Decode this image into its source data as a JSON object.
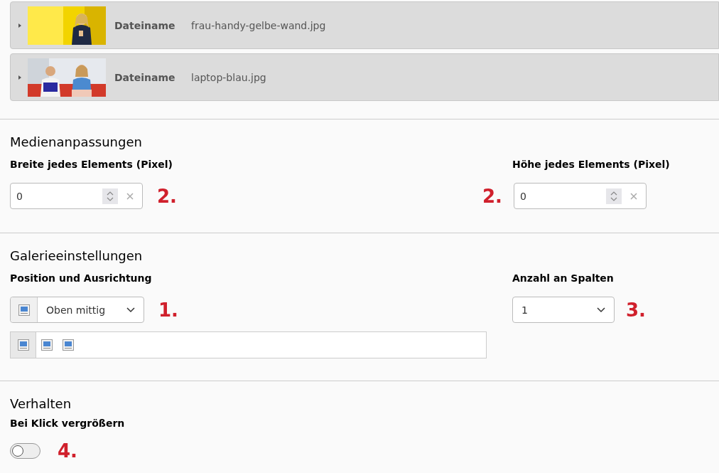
{
  "files": [
    {
      "label": "Dateiname",
      "filename": "frau-handy-gelbe-wand.jpg",
      "expanded": false
    },
    {
      "label": "Dateiname",
      "filename": "laptop-blau.jpg",
      "expanded": false
    }
  ],
  "media": {
    "title": "Medienanpassungen",
    "width": {
      "label": "Breite jedes Elements (Pixel)",
      "value": "0",
      "note": "2."
    },
    "height": {
      "label": "Höhe jedes Elements (Pixel)",
      "value": "0",
      "note": "2."
    }
  },
  "gallery": {
    "title": "Galerieeinstellungen",
    "position": {
      "label": "Position und Ausrichtung",
      "value": "Oben mittig",
      "note": "1.",
      "options": [
        {
          "selected": true
        },
        {
          "selected": false
        },
        {
          "selected": false
        }
      ]
    },
    "columns": {
      "label": "Anzahl an Spalten",
      "value": "1",
      "note": "3."
    }
  },
  "behavior": {
    "title": "Verhalten",
    "zoom": {
      "label": "Bei Klick vergrößern",
      "on": false,
      "note": "4."
    }
  }
}
